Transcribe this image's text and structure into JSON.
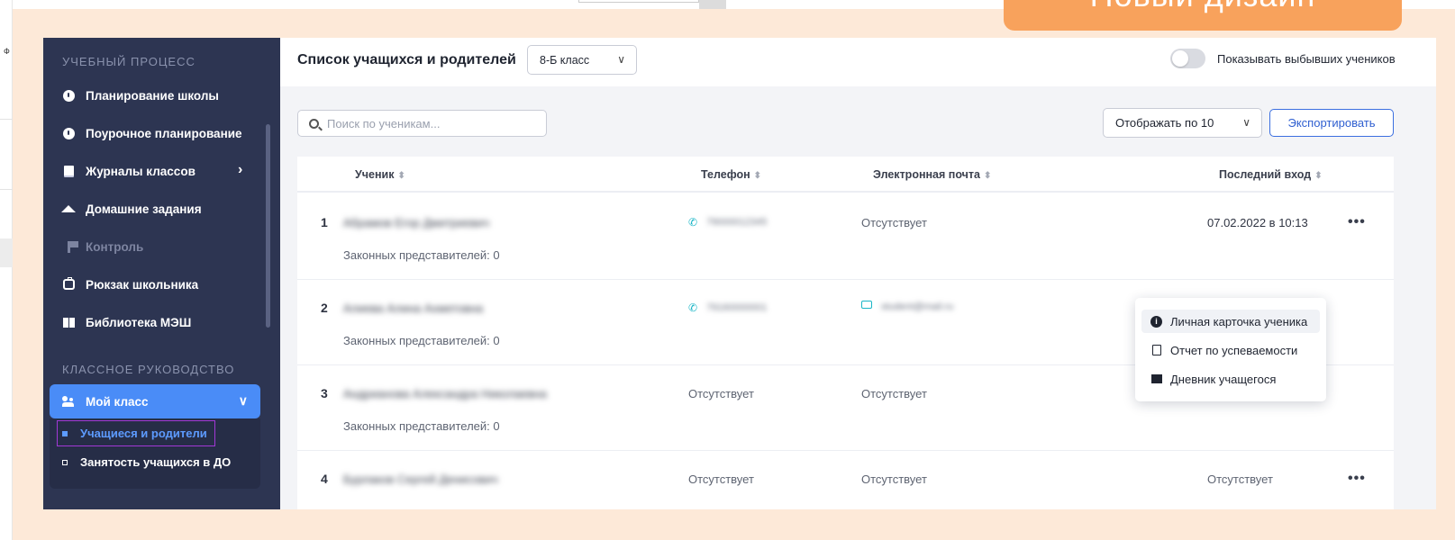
{
  "background": {
    "left_glyph": "Ф"
  },
  "banner": {
    "text": "Новый дизайн"
  },
  "sidebar": {
    "section1_title": "УЧЕБНЫЙ ПРОЦЕСС",
    "items": [
      {
        "label": "Планирование школы",
        "icon": "clock-icon"
      },
      {
        "label": "Поурочное планирование",
        "icon": "clock-icon"
      },
      {
        "label": "Журналы классов",
        "icon": "book-icon"
      },
      {
        "label": "Домашние задания",
        "icon": "graduation-cap-icon"
      },
      {
        "label": "Контроль",
        "icon": "flag-icon"
      },
      {
        "label": "Рюкзак школьника",
        "icon": "backpack-icon"
      },
      {
        "label": "Библиотека МЭШ",
        "icon": "library-icon"
      }
    ],
    "section2_title": "КЛАССНОЕ РУКОВОДСТВО",
    "my_class": "Мой класс",
    "subitems": [
      {
        "label": "Учащиеся и родители"
      },
      {
        "label": "Занятость учащихся в ДО"
      }
    ]
  },
  "header": {
    "title": "Список учащихся и родителей",
    "class_select": "8-Б класс",
    "toggle_label": "Показывать выбывших учеников",
    "toggle_on": false
  },
  "toolbar": {
    "search_placeholder": "Поиск по ученикам...",
    "per_page": "Отображать по 10",
    "export_label": "Экспортировать"
  },
  "table": {
    "columns": [
      "Ученик",
      "Телефон",
      "Электронная почта",
      "Последний вход"
    ],
    "rows": [
      {
        "num": "1",
        "name": "Абрамов Егор Дмитриевич",
        "reps": "Законных представителей: 0",
        "phone": "79000012345",
        "email": "Отсутствует",
        "last_login": "07.02.2022 в 10:13"
      },
      {
        "num": "2",
        "name": "Алиева Алина Ахметовна",
        "reps": "Законных представителей: 0",
        "phone": "79160000001",
        "email": "student@mail.ru",
        "last_login": ""
      },
      {
        "num": "3",
        "name": "Андрианова Александра Николаевна",
        "reps": "Законных представителей: 0",
        "phone": "Отсутствует",
        "email": "Отсутствует",
        "last_login": ""
      },
      {
        "num": "4",
        "name": "Бурлаков Сергей Денисович",
        "reps": "",
        "phone": "Отсутствует",
        "email": "Отсутствует",
        "last_login": "Отсутствует"
      }
    ]
  },
  "context_menu": {
    "items": [
      {
        "label": "Личная карточка ученика",
        "icon": "info-icon"
      },
      {
        "label": "Отчет по успеваемости",
        "icon": "document-icon"
      },
      {
        "label": "Дневник учащегося",
        "icon": "diary-icon"
      }
    ]
  },
  "colors": {
    "sidebar": "#2d3552",
    "accent": "#4a8cf7",
    "banner": "#f8a25c",
    "peach": "#fde9d8",
    "teal": "#19b5c6"
  }
}
